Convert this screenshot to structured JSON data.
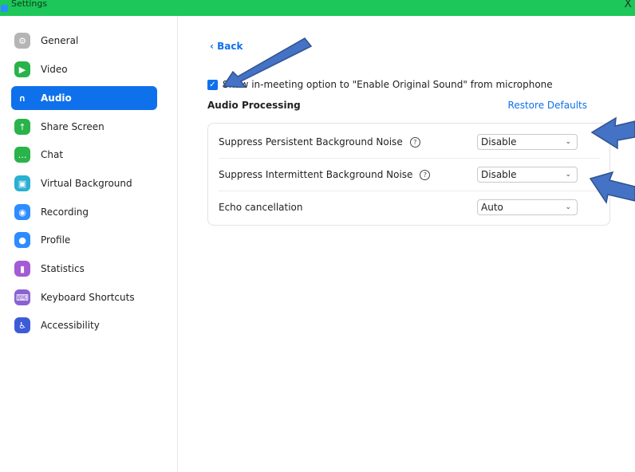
{
  "window": {
    "title": "Settings",
    "close_glyph": "X"
  },
  "sidebar": {
    "items": [
      {
        "label": "General",
        "icon": "gear-icon",
        "color": "#b5b5b5",
        "glyph": "⚙"
      },
      {
        "label": "Video",
        "icon": "video-icon",
        "color": "#29b34a",
        "glyph": "▶"
      },
      {
        "label": "Audio",
        "icon": "headphones-icon",
        "color": "#0e71eb",
        "glyph": "∩",
        "active": true
      },
      {
        "label": "Share Screen",
        "icon": "share-screen-icon",
        "color": "#29b34a",
        "glyph": "↑"
      },
      {
        "label": "Chat",
        "icon": "chat-icon",
        "color": "#29b34a",
        "glyph": "…"
      },
      {
        "label": "Virtual Background",
        "icon": "virtual-background-icon",
        "color": "#2ab0d1",
        "glyph": "▣"
      },
      {
        "label": "Recording",
        "icon": "recording-icon",
        "color": "#2d8cff",
        "glyph": "◉"
      },
      {
        "label": "Profile",
        "icon": "profile-icon",
        "color": "#2d8cff",
        "glyph": "●"
      },
      {
        "label": "Statistics",
        "icon": "statistics-icon",
        "color": "#a35bd6",
        "glyph": "▮"
      },
      {
        "label": "Keyboard Shortcuts",
        "icon": "keyboard-icon",
        "color": "#8a63d2",
        "glyph": "⌨"
      },
      {
        "label": "Accessibility",
        "icon": "accessibility-icon",
        "color": "#3d5bd9",
        "glyph": "♿"
      }
    ]
  },
  "main": {
    "back_label": "Back",
    "checkbox_label": "Show in-meeting option to \"Enable Original Sound\" from microphone",
    "checkbox_checked": true,
    "section_title": "Audio Processing",
    "restore_defaults": "Restore Defaults",
    "settings": [
      {
        "label": "Suppress Persistent Background Noise",
        "help": true,
        "value": "Disable"
      },
      {
        "label": "Suppress Intermittent Background Noise",
        "help": true,
        "value": "Disable"
      },
      {
        "label": "Echo cancellation",
        "help": false,
        "value": "Auto"
      }
    ]
  },
  "colors": {
    "accent": "#0e71eb",
    "titlebar": "#1ec75a",
    "annotation_arrow": "#4472c4"
  }
}
